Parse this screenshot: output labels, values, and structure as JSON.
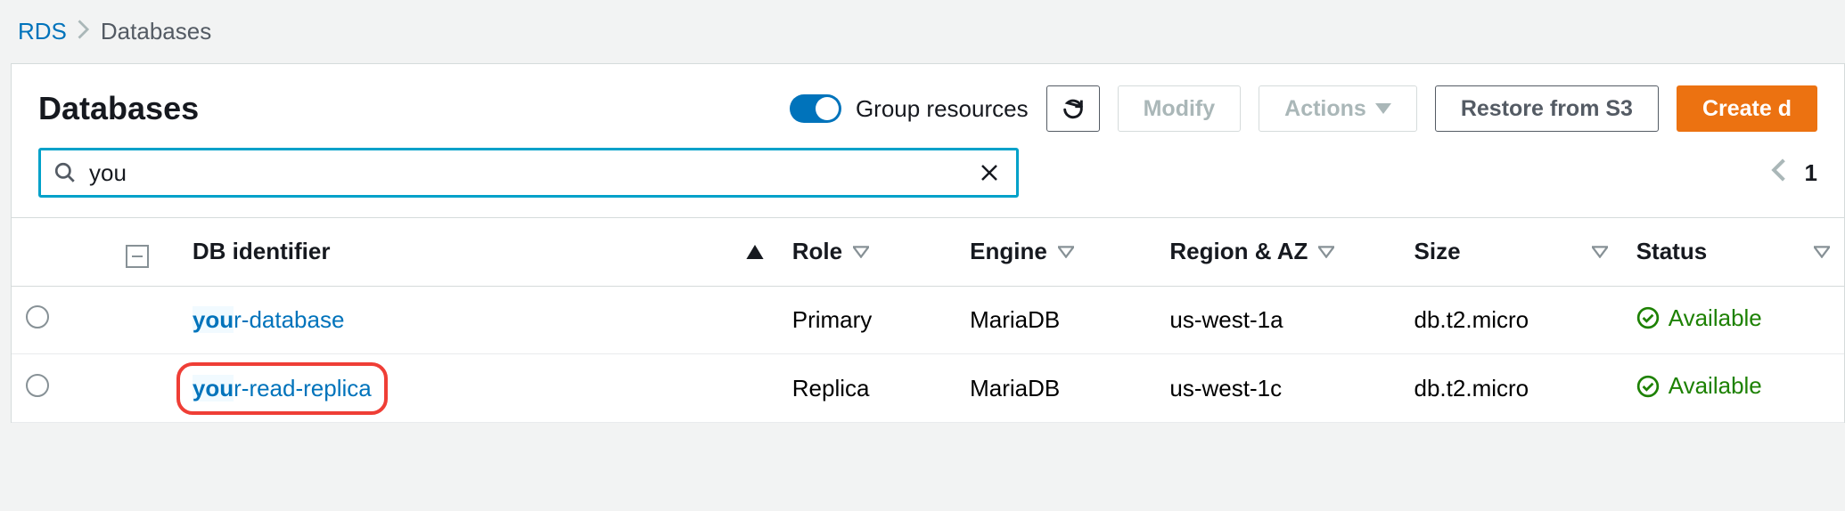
{
  "breadcrumb": {
    "root": "RDS",
    "current": "Databases"
  },
  "header": {
    "title": "Databases",
    "toggle_label": "Group resources",
    "toggle_on": true,
    "actions": {
      "refresh_icon": "refresh",
      "modify": "Modify",
      "actions": "Actions",
      "restore": "Restore from S3",
      "create": "Create d"
    }
  },
  "search": {
    "value": "you",
    "match_len": 3
  },
  "pagination": {
    "page": "1"
  },
  "table": {
    "columns": {
      "id": "DB identifier",
      "role": "Role",
      "engine": "Engine",
      "region": "Region & AZ",
      "size": "Size",
      "status": "Status"
    },
    "sort_column": "id",
    "sort_direction": "asc",
    "rows": [
      {
        "id": "your-database",
        "role": "Primary",
        "engine": "MariaDB",
        "region": "us-west-1a",
        "size": "db.t2.micro",
        "status": "Available",
        "status_ok": true,
        "highlighted": false
      },
      {
        "id": "your-read-replica",
        "role": "Replica",
        "engine": "MariaDB",
        "region": "us-west-1c",
        "size": "db.t2.micro",
        "status": "Available",
        "status_ok": true,
        "highlighted": true
      }
    ]
  },
  "colors": {
    "link": "#0073bb",
    "primary": "#ec7211",
    "status_ok": "#1d8102"
  }
}
